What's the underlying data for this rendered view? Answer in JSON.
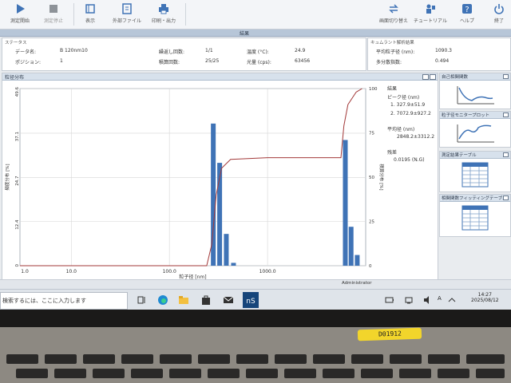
{
  "toolbar": {
    "items": [
      {
        "label": "測定開始",
        "icon": "play-icon"
      },
      {
        "label": "測定停止",
        "icon": "stop-icon"
      },
      {
        "label": "表示",
        "icon": "display-icon"
      },
      {
        "label": "外部ファイル",
        "icon": "file-icon"
      },
      {
        "label": "印刷・出力",
        "icon": "printer-icon"
      },
      {
        "label": "画面切り替え",
        "icon": "swap-icon"
      },
      {
        "label": "チュートリアル",
        "icon": "tutorial-icon"
      },
      {
        "label": "ヘルプ",
        "icon": "help-icon"
      },
      {
        "label": "終了",
        "icon": "power-icon"
      }
    ]
  },
  "tab_title": "結果",
  "status": {
    "header": "ステータス",
    "data_name_label": "データ名:",
    "data_name_value": "B 120nm10",
    "position_label": "ポジション:",
    "position_value": "1",
    "repeat_label": "繰返し回数:",
    "repeat_value": "1/1",
    "accum_label": "積算回数:",
    "accum_value": "25/25",
    "temp_label": "温度 (°C):",
    "temp_value": "24.9",
    "light_label": "光量 (cps):",
    "light_value": "63456"
  },
  "summary": {
    "header": "キュムラント解析結果",
    "avg_label": "平均粒子径 (nm):",
    "avg_value": "1090.3",
    "pdi_label": "多分散指数:",
    "pdi_value": "0.494"
  },
  "panel": {
    "title": "粒径分布"
  },
  "results": {
    "title": "結果",
    "peak_label": "ピーク径 (nm)",
    "peak_1": "1.  327.9±51.9",
    "peak_2": "2.  7072.9±927.2",
    "mean_label": "平均径 (nm)",
    "mean_value": "2848.2±3312.2",
    "resid_label": "残差",
    "resid_value": "0.0195  (N.G)"
  },
  "side": {
    "cards": [
      {
        "title": "自己相関関数"
      },
      {
        "title": "粒子径モニタープロット"
      },
      {
        "title": "測定結果テーブル"
      },
      {
        "title": "相関関数フィッティングテーブル"
      }
    ]
  },
  "bottom": {
    "admin": "Administrator"
  },
  "taskbar": {
    "search_placeholder": "検索するには、ここに入力します",
    "time": "14:27",
    "date": "2025/08/12",
    "ime": "A"
  },
  "laptop": {
    "sticker": "D01912"
  },
  "chart_data": {
    "type": "bar",
    "x_scale": "log",
    "xlabel": "粒子径 [nm]",
    "ylabel_left": "頻度分布 [%]",
    "ylabel_right": "積算分布 [%]",
    "xlim": [
      3,
      10000
    ],
    "ylim_left": [
      0,
      49.6
    ],
    "ylim_right": [
      0,
      100
    ],
    "x_ticks": [
      1.0,
      10.0,
      100.0,
      1000.0
    ],
    "x_tick_labels": [
      "1.0",
      "10.0",
      "100.0",
      "1000.0"
    ],
    "y_left_ticks": [
      0,
      12.4,
      24.7,
      37.1,
      49.6
    ],
    "y_left_tick_labels": [
      "0",
      "12.4",
      "24.7",
      "37.1",
      "49.6"
    ],
    "y_right_ticks": [
      0,
      25,
      50,
      75,
      100
    ],
    "y_right_tick_labels": [
      "0",
      "25",
      "50",
      "75",
      "100"
    ],
    "bars": [
      {
        "x": 280,
        "y": 39.8
      },
      {
        "x": 325,
        "y": 28.8
      },
      {
        "x": 380,
        "y": 8.9
      },
      {
        "x": 450,
        "y": 0.8
      },
      {
        "x": 6200,
        "y": 35.2
      },
      {
        "x": 7100,
        "y": 10.9
      },
      {
        "x": 8200,
        "y": 3.0
      }
    ],
    "cumulative": [
      [
        3,
        0
      ],
      [
        240,
        0
      ],
      [
        270,
        12
      ],
      [
        300,
        40
      ],
      [
        340,
        55
      ],
      [
        420,
        60
      ],
      [
        1000,
        61
      ],
      [
        5600,
        61
      ],
      [
        6000,
        79
      ],
      [
        6600,
        91
      ],
      [
        8000,
        98
      ],
      [
        9200,
        100
      ]
    ],
    "colors": {
      "bar": "#3f73b6",
      "cumulative": "#a33a3a",
      "grid": "#d6d6d6"
    }
  }
}
